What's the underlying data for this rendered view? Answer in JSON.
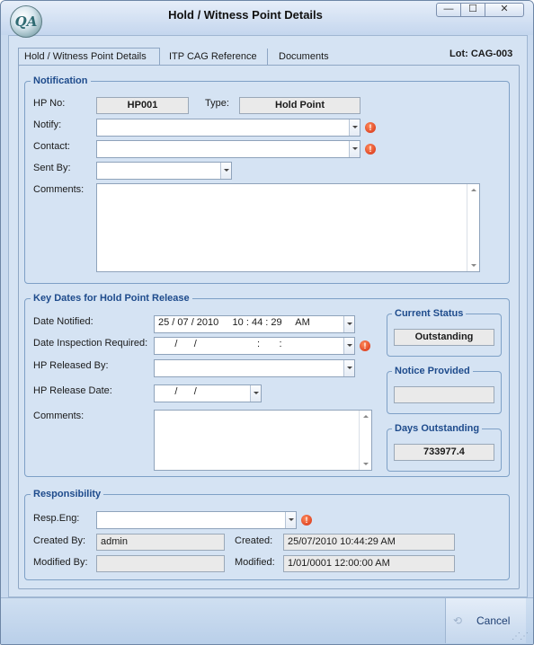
{
  "window": {
    "title": "Hold / Witness Point Details",
    "logo_text": "QA",
    "min_glyph": "—",
    "max_glyph": "☐",
    "close_glyph": "✕"
  },
  "tabs": [
    {
      "label": "Hold / Witness Point Details"
    },
    {
      "label": "ITP CAG Reference"
    },
    {
      "label": "Documents"
    }
  ],
  "lot": "Lot: CAG-003",
  "notification": {
    "legend": "Notification",
    "hp_no_label": "HP No:",
    "hp_no": "HP001",
    "type_label": "Type:",
    "type": "Hold Point",
    "notify_label": "Notify:",
    "notify_value": "",
    "contact_label": "Contact:",
    "contact_value": "",
    "sent_by_label": "Sent By:",
    "sent_by_value": "",
    "comments_label": "Comments:",
    "comments_value": ""
  },
  "key_dates": {
    "legend": "Key Dates for Hold Point Release",
    "date_notified_label": "Date Notified:",
    "date_notified": "25 / 07 / 2010     10 : 44 : 29     AM",
    "date_inspection_label": "Date Inspection Required:",
    "date_inspection": "      /      /                      :       :",
    "hp_released_by_label": "HP Released By:",
    "hp_released_by": "",
    "hp_release_date_label": "HP Release Date:",
    "hp_release_date": "      /      /",
    "comments_label": "Comments:",
    "comments_value": ""
  },
  "current_status": {
    "legend": "Current Status",
    "value": "Outstanding"
  },
  "notice_provided": {
    "legend": "Notice Provided",
    "value": ""
  },
  "days_outstanding": {
    "legend": "Days Outstanding",
    "value": "733977.4"
  },
  "responsibility": {
    "legend": "Responsibility",
    "resp_eng_label": "Resp.Eng:",
    "resp_eng": "",
    "created_by_label": "Created By:",
    "created_by": "admin",
    "created_label": "Created:",
    "created": "25/07/2010 10:44:29 AM",
    "modified_by_label": "Modified By:",
    "modified_by": "",
    "modified_label": "Modified:",
    "modified": "1/01/0001 12:00:00 AM"
  },
  "footer": {
    "cancel_label": "Cancel",
    "cancel_icon": "⟲"
  },
  "required_glyph": "!",
  "colors": {
    "accent": "#1e4b8c",
    "required": "#d32d12",
    "window_bg": "#d5e3f3"
  }
}
